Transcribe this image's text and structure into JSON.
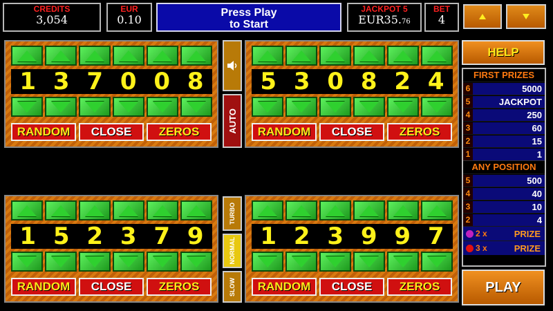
{
  "top": {
    "credits_label": "CREDITS",
    "credits_value": "3,054",
    "currency_label": "EUR",
    "currency_value": "0.10",
    "message_line1": "Press Play",
    "message_line2": "to Start",
    "jackpot_label": "JACKPOT 5",
    "jackpot_value": "EUR35.",
    "jackpot_cents": "76",
    "bet_label": "BET",
    "bet_value": "4"
  },
  "panels": [
    {
      "digits": [
        "1",
        "3",
        "7",
        "0",
        "0",
        "8"
      ]
    },
    {
      "digits": [
        "5",
        "3",
        "0",
        "8",
        "2",
        "4"
      ]
    },
    {
      "digits": [
        "1",
        "5",
        "2",
        "3",
        "7",
        "9"
      ]
    },
    {
      "digits": [
        "1",
        "2",
        "3",
        "9",
        "9",
        "7"
      ]
    }
  ],
  "actions": {
    "random": "RANDOM",
    "close": "CLOSE",
    "zeros": "ZEROS"
  },
  "middle": {
    "auto": "AUTO",
    "turbo": "TURBO",
    "normal": "NORMAL",
    "slow": "SLOW",
    "sound_icon": "speaker-icon"
  },
  "side": {
    "help": "HELP",
    "first_prizes_title": "FIRST PRIZES",
    "first_prizes": [
      {
        "n": "6",
        "v": "5000"
      },
      {
        "n": "5",
        "v": "JACKPOT"
      },
      {
        "n": "4",
        "v": "250"
      },
      {
        "n": "3",
        "v": "60"
      },
      {
        "n": "2",
        "v": "15"
      },
      {
        "n": "1",
        "v": "1"
      }
    ],
    "any_position_title": "ANY POSITION",
    "any_position": [
      {
        "n": "5",
        "v": "500"
      },
      {
        "n": "4",
        "v": "40"
      },
      {
        "n": "3",
        "v": "10"
      },
      {
        "n": "2",
        "v": "4"
      }
    ],
    "special": [
      {
        "mult": "2 x",
        "label": "PRIZE",
        "color": "#c020c0"
      },
      {
        "mult": "3 x",
        "label": "PRIZE",
        "color": "#e01010"
      }
    ],
    "play": "PLAY"
  }
}
